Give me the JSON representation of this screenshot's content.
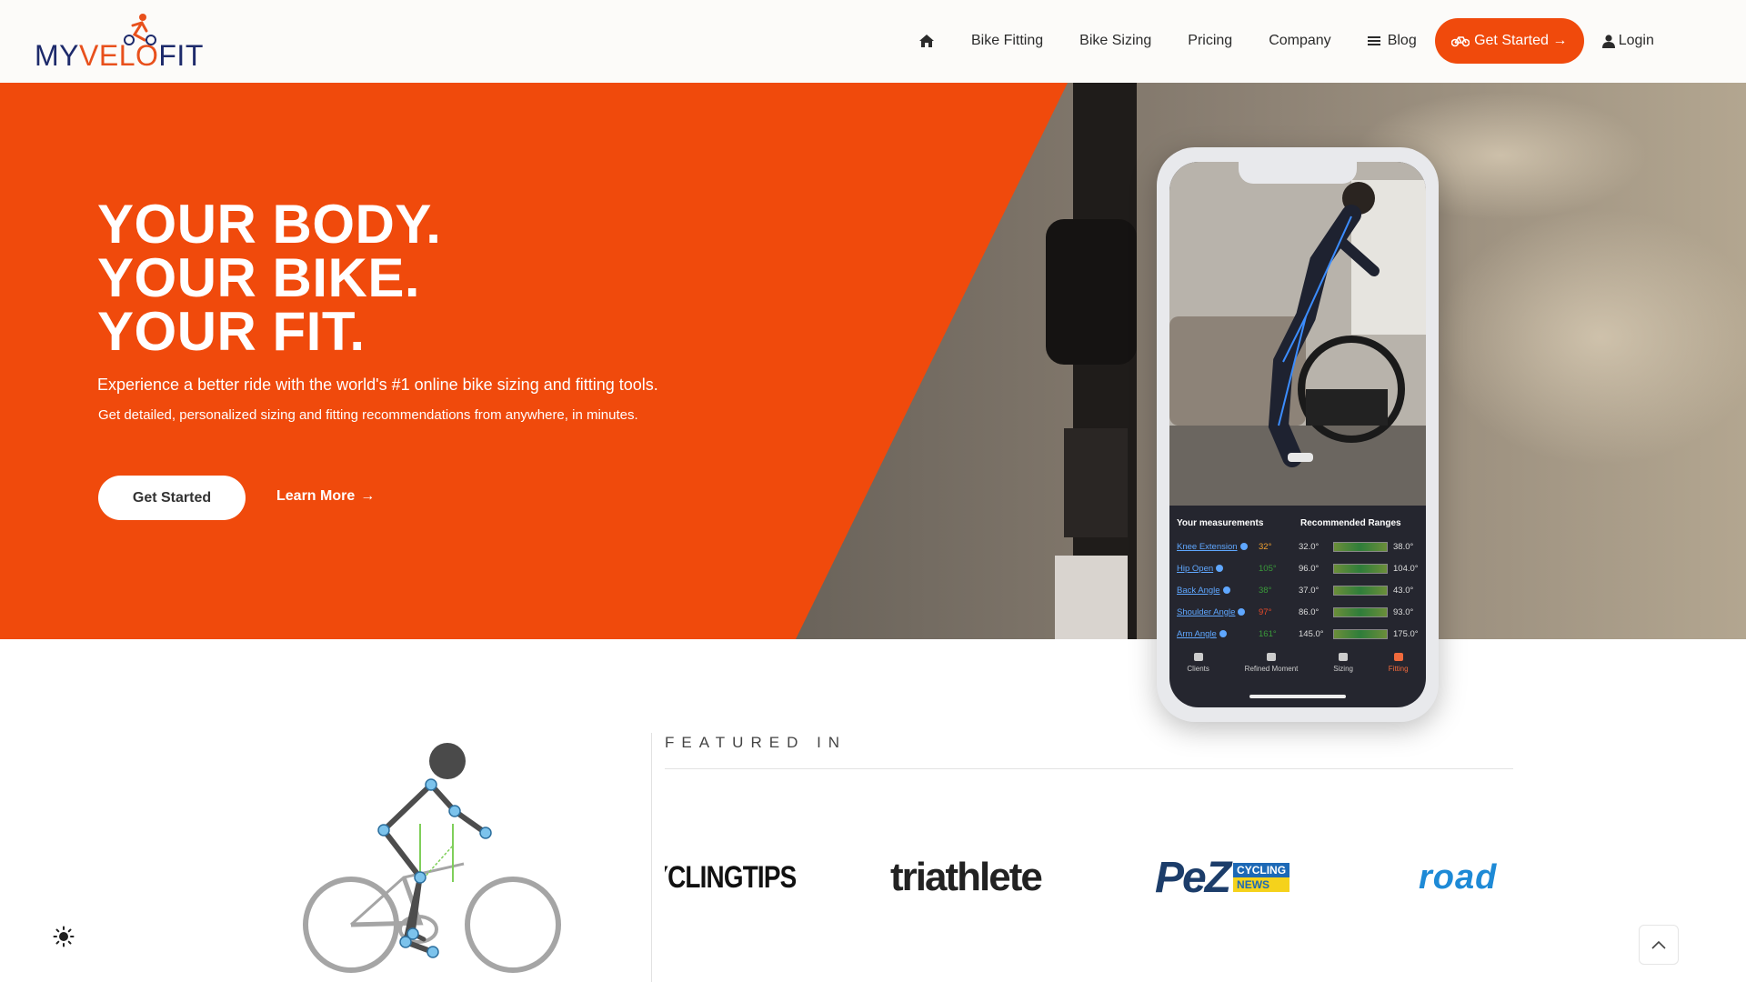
{
  "brand": {
    "logo_parts": [
      "MY",
      "VELO",
      "FIT"
    ],
    "accent": "#f04a0c",
    "navy": "#1d2a6b"
  },
  "nav": {
    "items": [
      "Bike Fitting",
      "Bike Sizing",
      "Pricing",
      "Company"
    ],
    "blog": "Blog",
    "cta": "Get Started →",
    "login": "Login"
  },
  "hero": {
    "title_lines": [
      "YOUR BODY.",
      "YOUR BIKE.",
      "YOUR FIT."
    ],
    "subtitle": "Experience a better ride with the world's #1 online bike sizing and fitting tools.",
    "subtitle2": "Get detailed, personalized sizing and fitting recommendations from anywhere, in minutes.",
    "primary_button": "Get Started",
    "secondary_button": "Learn More",
    "secondary_arrow": "→"
  },
  "phone": {
    "col_measurements": "Your measurements",
    "col_ranges": "Recommended Ranges",
    "rows": [
      {
        "name": "Knee Extension",
        "value": "32°",
        "value_color": "#f0a030",
        "min": "32.0°",
        "max": "38.0°"
      },
      {
        "name": "Hip Open",
        "value": "105°",
        "value_color": "#3a9a3a",
        "min": "96.0°",
        "max": "104.0°"
      },
      {
        "name": "Back Angle",
        "value": "38°",
        "value_color": "#3a9a3a",
        "min": "37.0°",
        "max": "43.0°"
      },
      {
        "name": "Shoulder Angle",
        "value": "97°",
        "value_color": "#e84a2a",
        "min": "86.0°",
        "max": "93.0°"
      },
      {
        "name": "Arm Angle",
        "value": "161°",
        "value_color": "#3a9a3a",
        "min": "145.0°",
        "max": "175.0°"
      }
    ],
    "tabs": [
      "Clients",
      "Refined Moment",
      "Sizing",
      "Fitting"
    ],
    "active_tab": "Fitting"
  },
  "featured": {
    "title": "FEATURED IN",
    "logos": {
      "cyclingtips": "CYCLINGTIPS",
      "triathlete": "triathlete",
      "pez": "PeZ",
      "pez_badge_top": "CYCLING",
      "pez_badge_bottom": "NEWS",
      "road": "road"
    }
  },
  "icons": {
    "home": "home-icon",
    "blog": "menu-icon",
    "cta": "bicycle-icon",
    "login": "user-icon",
    "theme": "sun-icon",
    "to_top": "chevron-up-icon"
  }
}
